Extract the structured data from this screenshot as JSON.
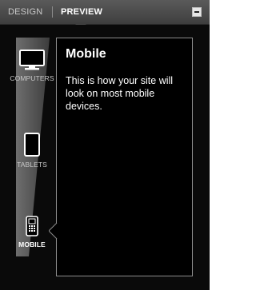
{
  "header": {
    "tabs": [
      {
        "label": "DESIGN",
        "active": false
      },
      {
        "label": "PREVIEW",
        "active": true
      }
    ],
    "collapse_icon": "minus-icon"
  },
  "devices": [
    {
      "label": "COMPUTERS",
      "icon": "monitor-icon",
      "active": false
    },
    {
      "label": "TABLETS",
      "icon": "tablet-icon",
      "active": false
    },
    {
      "label": "MOBILE",
      "icon": "mobile-phone-icon",
      "active": true
    }
  ],
  "info": {
    "title": "Mobile",
    "body": "This is how your site will look on most mobile devices."
  },
  "colors": {
    "background": "#0a0a0a",
    "header": "#4a4a4a",
    "text": "#ffffff",
    "border": "#8c8c8c"
  }
}
